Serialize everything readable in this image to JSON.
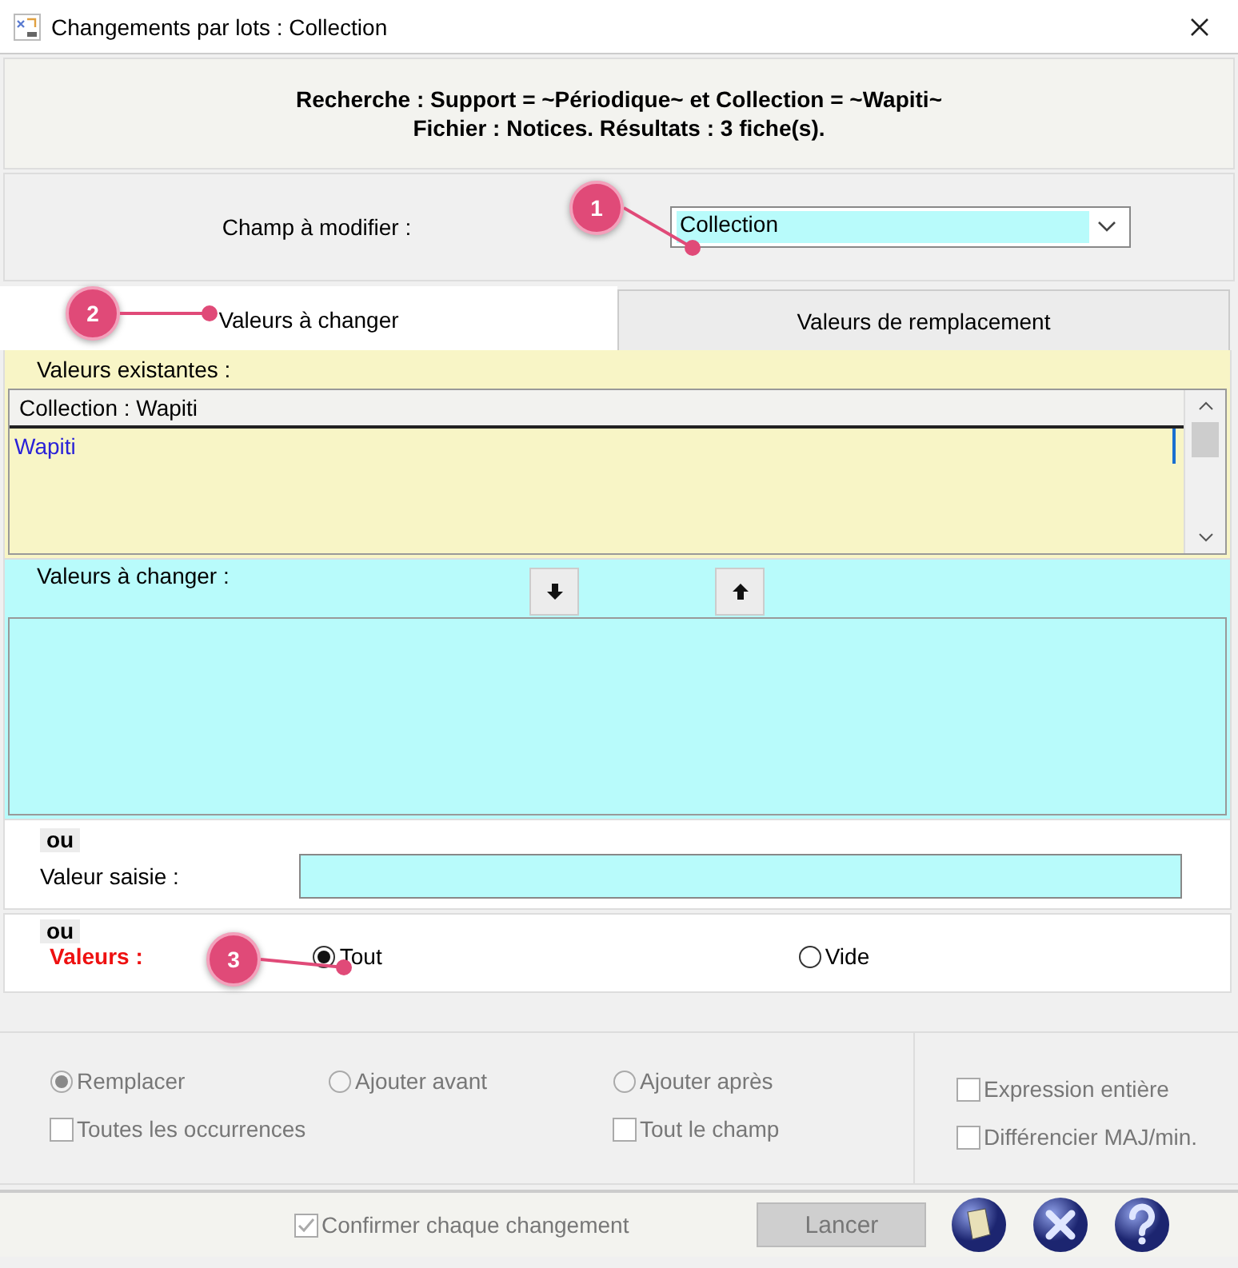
{
  "window": {
    "title": "Changements par lots : Collection"
  },
  "search_summary": [
    "Recherche : Support = ~Périodique~ et Collection = ~Wapiti~",
    "Fichier : Notices. Résultats : 3 fiche(s)."
  ],
  "field_to_modify": {
    "label": "Champ à modifier :",
    "value": "Collection"
  },
  "tabs": [
    {
      "label": "Valeurs à changer",
      "selected": true
    },
    {
      "label": "Valeurs de remplacement",
      "selected": false
    }
  ],
  "existing_values": {
    "label": "Valeurs existantes :",
    "header": "Collection  : Wapiti",
    "items": [
      "Wapiti"
    ]
  },
  "values_to_change": {
    "label": "Valeurs à changer :"
  },
  "entered_value": {
    "or": "ou",
    "label": "Valeur saisie :"
  },
  "values": {
    "or": "ou",
    "label": "Valeurs :",
    "options": [
      {
        "label": "Tout",
        "selected": true
      },
      {
        "label": "Vide",
        "selected": false
      }
    ]
  },
  "radio_options": [
    {
      "label": "Remplacer",
      "selected": true,
      "disabled": true
    },
    {
      "label": "Ajouter avant",
      "selected": false,
      "disabled": true
    },
    {
      "label": "Ajouter après",
      "selected": false,
      "disabled": true
    }
  ],
  "checkbox_options": [
    {
      "label": "Toutes les occurrences",
      "checked": false,
      "disabled": true
    },
    {
      "label": "Tout le champ",
      "checked": false,
      "disabled": true
    }
  ],
  "match_options": [
    {
      "label": "Expression entière",
      "checked": false,
      "disabled": true
    },
    {
      "label": "Différencier MAJ/min.",
      "checked": false,
      "disabled": true
    }
  ],
  "footer": {
    "confirm": {
      "label": "Confirmer chaque changement",
      "checked": true,
      "disabled": true
    },
    "run_button": {
      "label": "Lancer",
      "disabled": true
    }
  },
  "callouts": [
    {
      "number": "1"
    },
    {
      "number": "2"
    },
    {
      "number": "3"
    }
  ]
}
